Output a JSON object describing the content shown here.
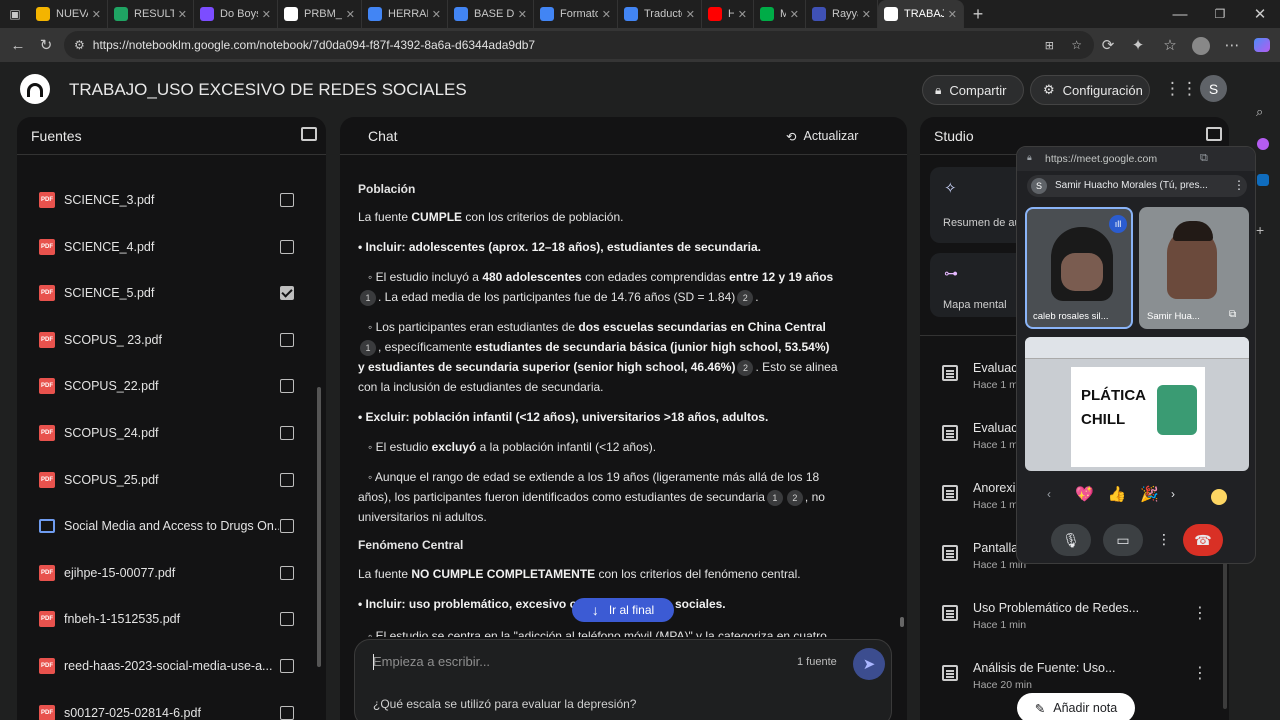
{
  "browser": {
    "tabs": [
      {
        "label": "NUEVA T",
        "color": "#f4b400"
      },
      {
        "label": "RESULTA",
        "color": "#1fa463"
      },
      {
        "label": "Do Boys",
        "color": "#7c4dff"
      },
      {
        "label": "PRBM_A",
        "color": "#ffffff"
      },
      {
        "label": "HERRAM",
        "color": "#4285f4"
      },
      {
        "label": "BASE DE",
        "color": "#4285f4"
      },
      {
        "label": "Formato",
        "color": "#4285f4"
      },
      {
        "label": "Traducto",
        "color": "#4285f4"
      },
      {
        "label": "Ha",
        "color": "#ff0000"
      },
      {
        "label": "Me",
        "color": "#00ac47"
      },
      {
        "label": "Rayyan",
        "color": "#3f51b5"
      },
      {
        "label": "TRABAJ",
        "color": "#ffffff"
      }
    ],
    "url": "https://notebooklm.google.com/notebook/7d0da094-f87f-4392-8a6a-d6344ada9db7"
  },
  "header": {
    "title": "TRABAJO_USO EXCESIVO DE REDES SOCIALES",
    "share_label": "Compartir",
    "settings_label": "Configuración",
    "avatar_letter": "S"
  },
  "sources": {
    "title": "Fuentes",
    "items": [
      {
        "label": "SCIENCE_3.pdf",
        "type": "pdf",
        "checked": false
      },
      {
        "label": "SCIENCE_4.pdf",
        "type": "pdf",
        "checked": false
      },
      {
        "label": "SCIENCE_5.pdf",
        "type": "pdf",
        "checked": true
      },
      {
        "label": "SCOPUS_ 23.pdf",
        "type": "pdf",
        "checked": false
      },
      {
        "label": "SCOPUS_22.pdf",
        "type": "pdf",
        "checked": false
      },
      {
        "label": "SCOPUS_24.pdf",
        "type": "pdf",
        "checked": false
      },
      {
        "label": "SCOPUS_25.pdf",
        "type": "pdf",
        "checked": false
      },
      {
        "label": "Social Media and Access to Drugs On...",
        "type": "doc",
        "checked": false
      },
      {
        "label": "ejihpe-15-00077.pdf",
        "type": "pdf",
        "checked": false
      },
      {
        "label": "fnbeh-1-1512535.pdf",
        "type": "pdf",
        "checked": false
      },
      {
        "label": "reed-haas-2023-social-media-use-a...",
        "type": "pdf",
        "checked": false
      },
      {
        "label": "s00127-025-02814-6.pdf",
        "type": "pdf",
        "checked": false
      }
    ]
  },
  "chat": {
    "title": "Chat",
    "refresh_label": "Actualizar",
    "jump_label": "Ir al final",
    "input_placeholder": "Empieza a escribir...",
    "source_count": "1 fuente",
    "suggestion": "¿Qué escala se utilizó para evaluar la depresión?",
    "h_poblacion": "Población",
    "p1a": "La fuente ",
    "p1b": "CUMPLE",
    "p1c": " con los criterios de población.",
    "inc1": "• Incluir: adolescentes (aprox. 12–18 años), estudiantes de secundaria.",
    "l1a": "◦ El estudio incluyó a ",
    "l1b": "480 adolescentes",
    "l1c": " con edades comprendidas ",
    "l1d": "entre 12 y 19 años",
    "l1e": ". La edad media de los participantes fue de 14.76 años (SD = 1.84)",
    "l2a": "◦ Los participantes eran estudiantes de ",
    "l2b": "dos escuelas secundarias en China Central",
    "l2c": ", específicamente ",
    "l2d": "estudiantes de secundaria básica (junior high school, 53.54%) y estudiantes de secundaria superior (senior high school, 46.46%)",
    "l2e": ". Esto se alinea con la inclusión de estudiantes de secundaria.",
    "exc1": "• Excluir: población infantil (<12 años), universitarios >18 años, adultos.",
    "l3a": "◦ El estudio ",
    "l3b": "excluyó",
    "l3c": " a la población infantil (<12 años).",
    "l4a": "◦ Aunque el rango de edad se extiende a los 19 años (ligeramente más allá de los 18 años), los participantes fueron identificados como estudiantes de secundaria",
    "l4b": ", no universitarios ni adultos.",
    "h_fenomeno": "Fenómeno Central",
    "p2a": "La fuente ",
    "p2b": "NO CUMPLE COMPLETAMENTE",
    "p2c": " con los criterios del fenómeno central.",
    "inc2a": "• Incluir: uso problemático, excesivo o",
    "inc2b": "sociales.",
    "l5": "◦ El estudio se centra en la \"adicción al teléfono móvil (MPA)\" y la categoriza en cuatro",
    "cite1": "1",
    "cite2": "2"
  },
  "studio": {
    "title": "Studio",
    "card1": "Resumen de au",
    "card2": "Mapa mental",
    "notes": [
      {
        "title": "Evaluac",
        "time": "Hace 1 m"
      },
      {
        "title": "Evaluac",
        "time": "Hace 1 m"
      },
      {
        "title": "Anorexi",
        "time": "Hace 1 m"
      },
      {
        "title": "Pantalla",
        "time": "Hace 1 min"
      },
      {
        "title": "Uso Problemático de Redes...",
        "time": "Hace 1 min"
      },
      {
        "title": "Análisis de Fuente: Uso...",
        "time": "Hace 20 min"
      }
    ],
    "add_note": "Añadir nota"
  },
  "meet": {
    "url": "https://meet.google.com",
    "presenter": "Samir Huacho Morales (Tú, pres...",
    "presenter_initial": "S",
    "tile1": "caleb rosales sil...",
    "tile2": "Samir Hua...",
    "slide_text_1": "PLÁTICA",
    "slide_text_2": "CHILL",
    "reactions": [
      "💖",
      "👍",
      "🎉"
    ]
  }
}
